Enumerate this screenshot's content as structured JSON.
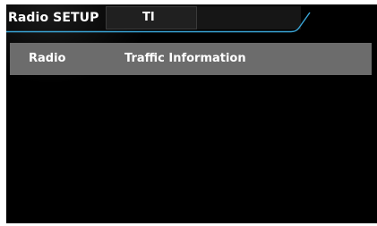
{
  "header": {
    "title": "Radio SETUP",
    "tabs": [
      {
        "label": "TI"
      }
    ],
    "accent_color": "#3aa6d8"
  },
  "settings": {
    "rows": [
      {
        "category": "Radio",
        "label": "Traffic Information"
      }
    ]
  }
}
